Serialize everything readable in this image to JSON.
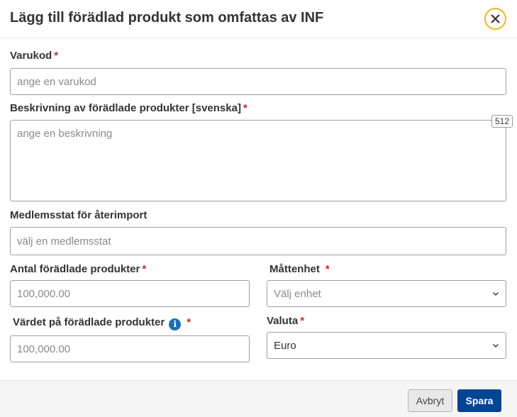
{
  "dialog": {
    "title": "Lägg till förädlad produkt som omfattas av INF",
    "close_icon": "close-icon"
  },
  "fields": {
    "varukod": {
      "label": "Varukod",
      "required_mark": "*",
      "value": "",
      "placeholder": "ange en varukod"
    },
    "beskrivning": {
      "label": "Beskrivning av förädlade produkter [svenska]",
      "required_mark": "*",
      "value": "",
      "placeholder": "ange en beskrivning",
      "char_counter": "512"
    },
    "medlemsstat": {
      "label": "Medlemsstat för återimport",
      "value": "",
      "placeholder": "välj en medlemsstat"
    },
    "antal": {
      "label": "Antal förädlade produkter",
      "required_mark": "*",
      "value": "",
      "placeholder": "100,000.00"
    },
    "mattenhet": {
      "label": "Måttenhet",
      "required_mark": "*",
      "placeholder": "Välj enhet",
      "selected": ""
    },
    "vardet": {
      "label": "Värdet på förädlade produkter",
      "info_icon": "i",
      "required_mark": "*",
      "value": "",
      "placeholder": "100,000.00"
    },
    "valuta": {
      "label": "Valuta",
      "required_mark": "*",
      "selected": "Euro"
    }
  },
  "footer": {
    "cancel_label": "Avbryt",
    "save_label": "Spara"
  },
  "colors": {
    "primary": "#004494",
    "required": "#c0282d",
    "close_ring": "#f2b71e",
    "info": "#1a6fb5"
  }
}
